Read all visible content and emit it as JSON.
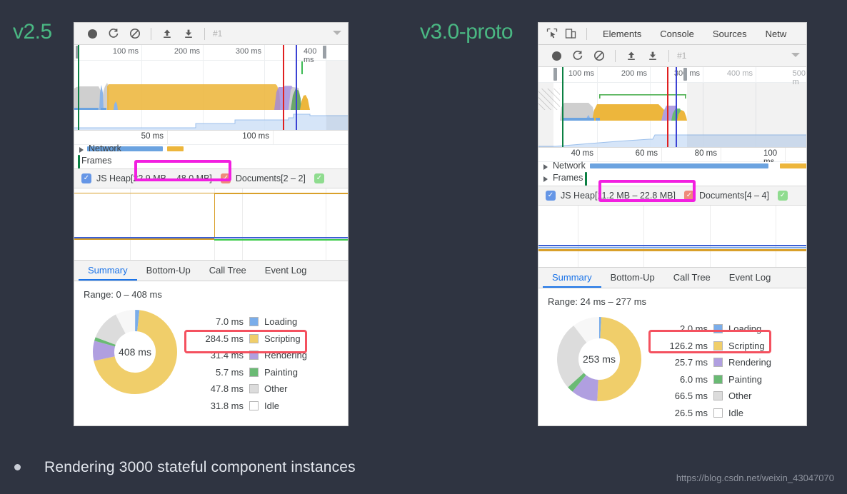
{
  "background_color": "#2f3441",
  "accent_green": "#4ab883",
  "labels": {
    "left": "v2.5",
    "right": "v3.0-proto"
  },
  "footer": {
    "bullet_text": "Rendering 3000 stateful component instances",
    "watermark": "https://blog.csdn.net/weixin_43047070"
  },
  "devtools_tabs": {
    "icons": [
      "inspect-element-icon",
      "device-toolbar-icon"
    ],
    "items": [
      "Elements",
      "Console",
      "Sources",
      "Netw"
    ]
  },
  "recorder_toolbar": {
    "icons": [
      "record-icon",
      "reload-icon",
      "clear-icon",
      "upload-icon",
      "download-icon"
    ],
    "field_value": "#1",
    "caret": "dropdown-caret-icon"
  },
  "left_panel": {
    "overview_ticks": [
      "100 ms",
      "200 ms",
      "300 ms",
      "400 ms"
    ],
    "timeline_ticks": [
      "50 ms",
      "100 ms"
    ],
    "tracks": [
      {
        "label": "Network"
      },
      {
        "label": "Frames"
      }
    ],
    "counters": [
      {
        "label": "JS Heap",
        "value": "[22.9 MB – 48.0 MB]",
        "color": "#6596e6"
      },
      {
        "label": "Documents",
        "value": "[2 – 2]",
        "color": "#ef8a7a"
      },
      {
        "label": "",
        "value": "",
        "color": "#8fdc8f"
      }
    ],
    "bottom_tabs": [
      "Summary",
      "Bottom-Up",
      "Call Tree",
      "Event Log"
    ],
    "active_tab": "Summary",
    "range": "Range: 0 – 408 ms",
    "chart_data": {
      "type": "pie",
      "title": "Range: 0 – 408 ms",
      "center_label": "408 ms",
      "total_ms": 408,
      "categories": [
        "Loading",
        "Scripting",
        "Rendering",
        "Painting",
        "Other",
        "Idle"
      ],
      "values": [
        7.0,
        284.5,
        31.4,
        5.7,
        47.8,
        31.8
      ],
      "value_labels": [
        "7.0 ms",
        "284.5 ms",
        "31.4 ms",
        "5.7 ms",
        "47.8 ms",
        "31.8 ms"
      ],
      "colors": [
        "#7aadea",
        "#f0ce6a",
        "#b09fe0",
        "#6aba74",
        "#dcdcdc",
        "#f7f7f7"
      ],
      "legend_position": "right",
      "highlighted": "Scripting"
    }
  },
  "right_panel": {
    "overview_ticks": [
      "100 ms",
      "200 ms",
      "300 ms",
      "400 ms",
      "500 m"
    ],
    "timeline_ticks": [
      "40 ms",
      "60 ms",
      "80 ms",
      "100 ms"
    ],
    "tracks": [
      {
        "label": "Network"
      },
      {
        "label": "Frames"
      }
    ],
    "counters": [
      {
        "label": "JS Heap",
        "value": "[11.2 MB – 22.8 MB]",
        "color": "#6596e6"
      },
      {
        "label": "Documents",
        "value": "[4 – 4]",
        "color": "#ef8a7a"
      },
      {
        "label": "",
        "value": "",
        "color": "#8fdc8f"
      }
    ],
    "bottom_tabs": [
      "Summary",
      "Bottom-Up",
      "Call Tree",
      "Event Log"
    ],
    "active_tab": "Summary",
    "range": "Range: 24 ms – 277 ms",
    "chart_data": {
      "type": "pie",
      "title": "Range: 24 ms – 277 ms",
      "center_label": "253 ms",
      "total_ms": 253,
      "categories": [
        "Loading",
        "Scripting",
        "Rendering",
        "Painting",
        "Other",
        "Idle"
      ],
      "values": [
        2.0,
        126.2,
        25.7,
        6.0,
        66.5,
        26.5
      ],
      "value_labels": [
        "2.0 ms",
        "126.2 ms",
        "25.7 ms",
        "6.0 ms",
        "66.5 ms",
        "26.5 ms"
      ],
      "colors": [
        "#7aadea",
        "#f0ce6a",
        "#b09fe0",
        "#6aba74",
        "#dcdcdc",
        "#f7f7f7"
      ],
      "legend_position": "right",
      "highlighted": "Scripting"
    }
  }
}
